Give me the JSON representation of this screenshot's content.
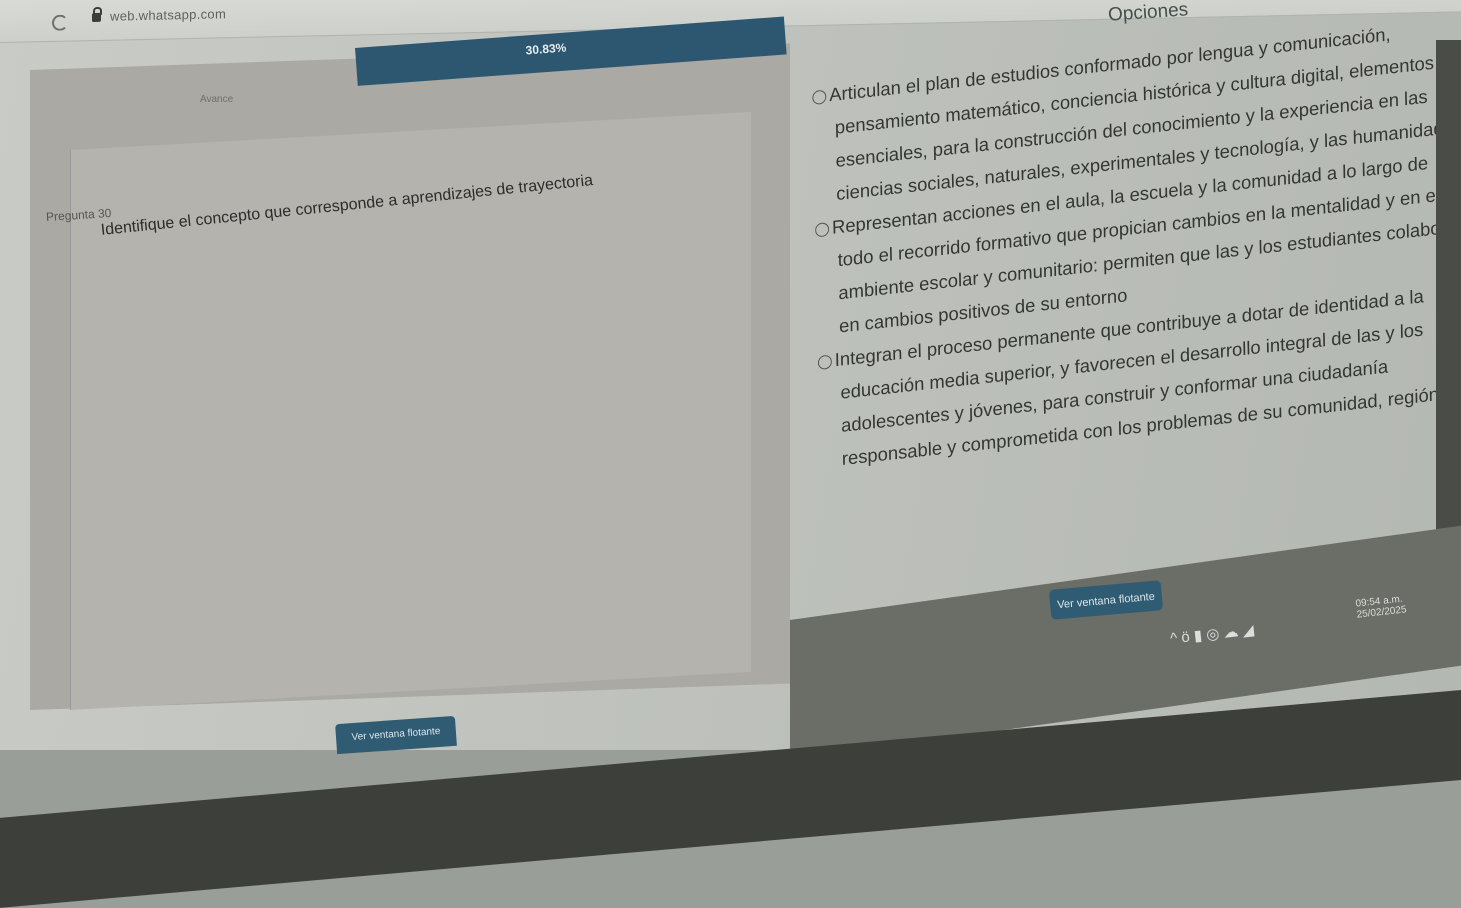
{
  "browser": {
    "url": "web.whatsapp.com"
  },
  "header": {
    "progress_text": "30.83%",
    "options_title": "Opciones",
    "small_label": "Avance"
  },
  "question": {
    "number_label": "Pregunta 30",
    "text": "Identifique el concepto que corresponde a aprendizajes de trayectoria"
  },
  "options": [
    {
      "lines": [
        "Articulan el plan de estudios conformado por lengua y comunicación,",
        "pensamiento matemático, conciencia histórica y cultura digital, elementos",
        "esenciales, para la construcción del conocimiento y la experiencia en las",
        "ciencias sociales, naturales, experimentales y tecnología, y las humanidades"
      ]
    },
    {
      "lines": [
        "Representan acciones en el aula, la escuela y la comunidad a lo largo de",
        "todo el recorrido formativo que propician cambios en la mentalidad y en el",
        "ambiente escolar y comunitario: permiten que las y los estudiantes colaboren",
        "en cambios positivos de su entorno"
      ]
    },
    {
      "lines": [
        "Integran el proceso permanente que contribuye a dotar de identidad a la",
        "educación media superior, y favorecen el desarrollo integral de las y los",
        "adolescentes y jóvenes, para construir y conformar una ciudadanía",
        "responsable y comprometida con los problemas de su comunidad, región"
      ]
    }
  ],
  "buttons": {
    "primary": "Ver ventana flotante",
    "secondary": "Ver ventana flotante"
  },
  "taskbar": {
    "clock": "09:54 a.m.",
    "date": "25/02/2025",
    "icons": "^ ö ▮ ◎ ☁ ◢"
  }
}
